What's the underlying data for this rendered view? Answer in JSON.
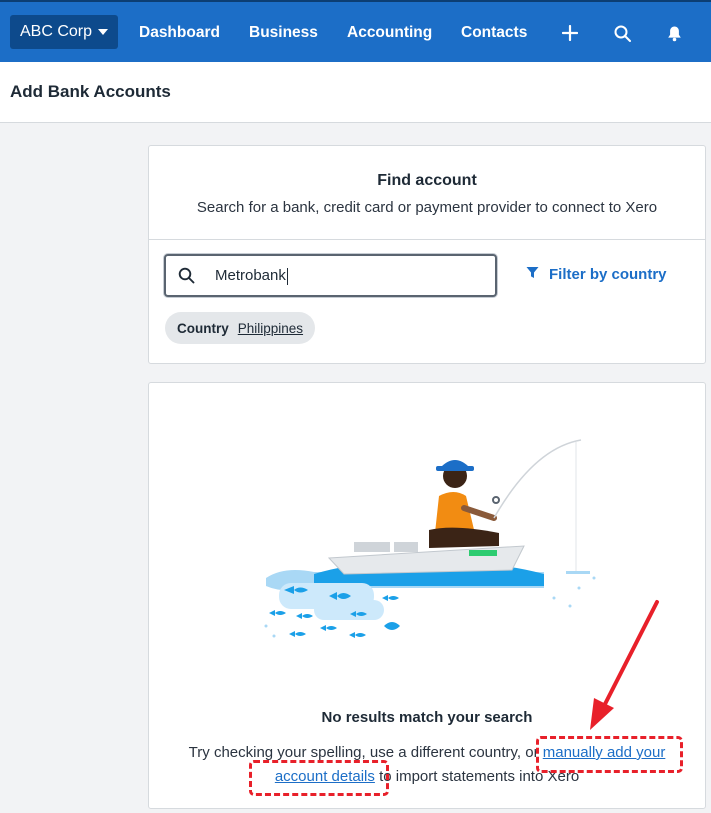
{
  "nav": {
    "org_label": "ABC Corp",
    "links": [
      "Dashboard",
      "Business",
      "Accounting",
      "Contacts"
    ],
    "icons": [
      "plus-icon",
      "search-icon",
      "bell-icon"
    ]
  },
  "header": {
    "title": "Add Bank Accounts"
  },
  "find_card": {
    "title": "Find account",
    "subtitle": "Search for a bank, credit card or payment provider to connect to Xero",
    "search_value": "Metrobank",
    "filter_label": "Filter by country",
    "chip_key": "Country",
    "chip_value": "Philippines"
  },
  "results": {
    "heading": "No results match your search",
    "help_prefix": "Try checking your spelling, use a different country, or",
    "help_link_1": "manually add your",
    "help_link_2": "account details",
    "help_suffix": "to import statements into Xero"
  },
  "colors": {
    "nav_bg": "#1c6ec7",
    "org_bg": "#0d4a8c",
    "link": "#1c6ec7",
    "annotation": "#e8202a"
  }
}
